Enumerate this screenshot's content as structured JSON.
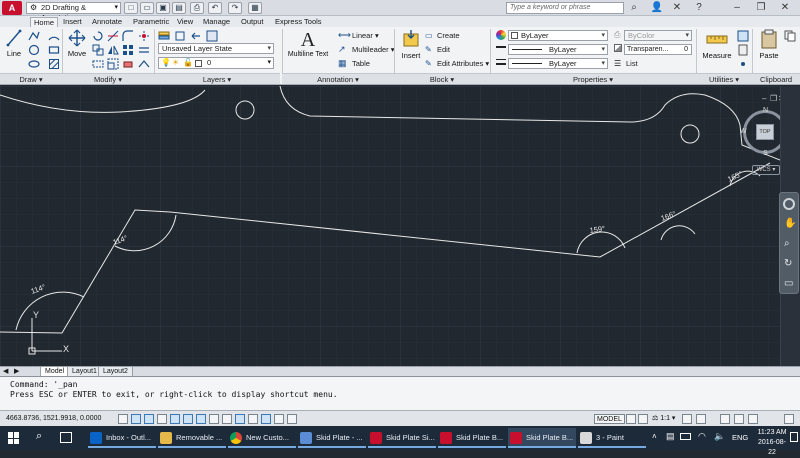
{
  "titlebar": {
    "workspace": "2D Drafting & Annotation",
    "search_placeholder": "Type a keyword or phrase"
  },
  "ribbon_tabs": [
    "Home",
    "Insert",
    "Annotate",
    "Parametric",
    "View",
    "Manage",
    "Output",
    "Express Tools"
  ],
  "ribbon": {
    "draw": {
      "line": "Line",
      "title": "Draw"
    },
    "modify": {
      "move": "Move",
      "title": "Modify"
    },
    "layers": {
      "layer_state": "Unsaved Layer State",
      "current_layer": "0",
      "title": "Layers"
    },
    "annotation": {
      "multiline_text": "Multiline Text",
      "linear": "Linear",
      "multileader": "Multileader",
      "table": "Table",
      "title": "Annotation"
    },
    "block": {
      "insert": "Insert",
      "create": "Create",
      "edit": "Edit",
      "edit_attributes": "Edit Attributes",
      "title": "Block"
    },
    "properties": {
      "color": "ByLayer",
      "linetype": "ByLayer",
      "lineweight": "ByLayer",
      "plot_style": "ByColor",
      "transparency_label": "Transparen...",
      "transparency_value": "0",
      "list": "List",
      "title": "Properties"
    },
    "utilities": {
      "measure": "Measure",
      "title": "Utilities"
    },
    "clipboard": {
      "paste": "Paste",
      "title": "Clipboard"
    }
  },
  "viewcube": {
    "n": "N",
    "s": "S",
    "e": "E",
    "w": "W",
    "top": "TOP",
    "ucs": "WCS"
  },
  "drawing": {
    "angles": [
      "114°",
      "114°",
      "159°",
      "166°",
      "165°"
    ]
  },
  "layout_tabs": [
    "Model",
    "Layout1",
    "Layout2"
  ],
  "command": {
    "line1": "Command: '_pan",
    "line2": "Press ESC or ENTER to exit, or right-click to display shortcut menu."
  },
  "statusbar": {
    "coords": "4663.8736, 1521.9918, 0.0000",
    "model": "MODEL",
    "scale": "1:1"
  },
  "taskbar": {
    "items": [
      "Inbox - Outl...",
      "Removable ...",
      "New Custo...",
      "Skid Plate - ...",
      "Skid Plate Si...",
      "Skid Plate B...",
      "Skid Plate B...",
      "3 - Paint"
    ],
    "lang": "ENG",
    "time": "11:23 AM",
    "date": "2016-08-22"
  },
  "colors": {
    "canvas": "#212830",
    "accent": "#1e6fbf",
    "autocad_red": "#c8102e"
  }
}
